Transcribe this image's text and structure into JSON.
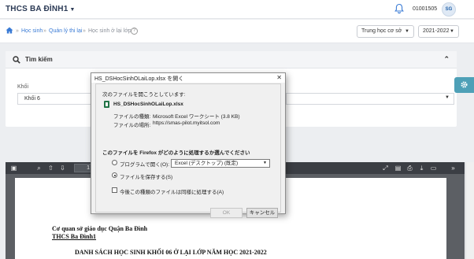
{
  "header": {
    "school": "THCS BA ĐÌNH1",
    "user_id": "01001505",
    "avatar_text": "SG"
  },
  "breadcrumb": {
    "items": [
      "Học sinh",
      "Quản lý thi lại",
      "Học sinh ở lại lớp"
    ],
    "separator": "»"
  },
  "filters": {
    "level": "Trung học cơ sở",
    "year": "2021-2022"
  },
  "search_panel": {
    "title": "Tìm kiếm",
    "khoi_label": "Khối",
    "khoi_value": "Khối 6"
  },
  "pdf_viewer": {
    "page_number": "1",
    "doc_lines": [
      "Cơ quan sở giáo dục Quận Ba Đình",
      "THCS Ba Đình1",
      "DANH SÁCH HỌC SINH KHỐI 06 Ở LẠI LỚP NĂM HỌC 2021-2022"
    ]
  },
  "dialog": {
    "title": "HS_DSHocSinhOLaiLop.xlsx を開く",
    "prompt": "次のファイルを開こうとしています:",
    "filename": "HS_DSHocSinhOLaiLop.xlsx",
    "type_label": "ファイルの種類:",
    "type_value": "Microsoft Excel ワークシート (3.8 KB)",
    "source_label": "ファイルの場所:",
    "source_value": "https://smas-pilot.myitsol.com",
    "question": "このファイルを Firefox がどのように処理するか選んでください",
    "open_with_label": "プログラムで開く(O):",
    "open_with_app": "Excel (デスクトップ) (既定)",
    "save_label": "ファイルを保存する(S)",
    "remember_label": "今後この種類のファイルは同様に処理する(A)",
    "ok": "OK",
    "cancel": "キャンセル"
  }
}
